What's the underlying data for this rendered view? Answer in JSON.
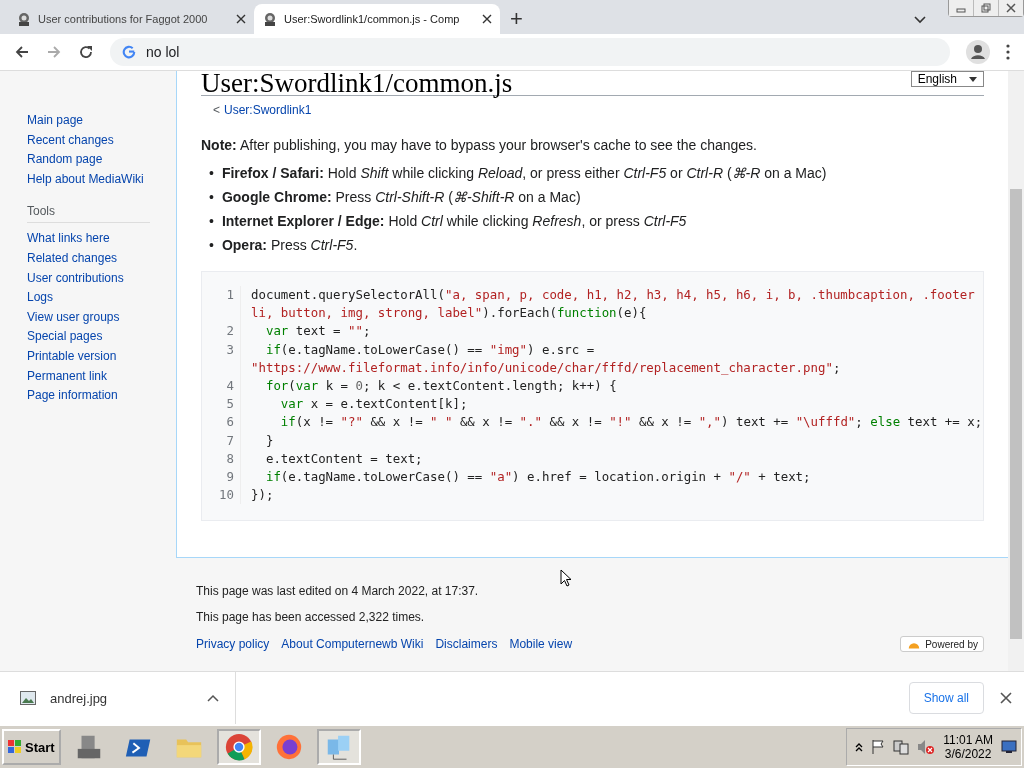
{
  "browser": {
    "tabs": [
      {
        "title": "User contributions for Faggot 2000",
        "selected": false
      },
      {
        "title": "User:Swordlink1/common.js - Comp",
        "selected": true
      }
    ],
    "new_tab": "+",
    "address": "no lol"
  },
  "sidebar": {
    "navigation": [
      "Main page",
      "Recent changes",
      "Random page",
      "Help about MediaWiki"
    ],
    "tools_heading": "Tools",
    "tools": [
      "What links here",
      "Related changes",
      "User contributions",
      "Logs",
      "View user groups",
      "Special pages",
      "Printable version",
      "Permanent link",
      "Page information"
    ]
  },
  "page": {
    "title": "User:Swordlink1/common.js",
    "language": "English",
    "breadcrumb_prefix": "<",
    "breadcrumb": "User:Swordlink1",
    "note": "**Note:** After publishing, you may have to bypass your browser's cache to see the changes.",
    "bullets": [
      {
        "marker": "•",
        "text": "**Firefox / Safari:** Hold *Shift* while clicking *Reload*, or press either *Ctrl-F5* or *Ctrl-R* (*⌘-R* on a Mac)"
      },
      {
        "marker": "•",
        "text": "**Google Chrome:** Press *Ctrl-Shift-R* (*⌘-Shift-R* on a Mac)"
      },
      {
        "marker": "•",
        "text": "**Internet Explorer / Edge:** Hold *Ctrl* while clicking *Refresh*, or press *Ctrl-F5*"
      },
      {
        "marker": "•",
        "text": "**Opera:** Press *Ctrl-F5*."
      }
    ],
    "code": [
      {
        "number": "1",
        "tokens": [
          {
            "kind": "plain",
            "text": "document.querySelectorAll("
          },
          {
            "kind": "string",
            "text": "\"a, span, p, code, h1, h2, h3, h4, h5, h6, i, b, .thumbcaption, .footer li, button, img, strong, label\""
          },
          {
            "kind": "plain",
            "text": ").forEach("
          },
          {
            "kind": "keyword",
            "text": "function"
          },
          {
            "kind": "plain",
            "text": "(e){"
          }
        ]
      },
      {
        "number": "2",
        "tokens": [
          {
            "kind": "keyword",
            "text": "  var"
          },
          {
            "kind": "plain",
            "text": " text = "
          },
          {
            "kind": "string",
            "text": "\"\""
          },
          {
            "kind": "plain",
            "text": ";"
          }
        ]
      },
      {
        "number": "3",
        "tokens": [
          {
            "kind": "keyword",
            "text": "  if"
          },
          {
            "kind": "plain",
            "text": "(e.tagName.toLowerCase() == "
          },
          {
            "kind": "string",
            "text": "\"img\""
          },
          {
            "kind": "plain",
            "text": ") e.src = "
          },
          {
            "kind": "string",
            "text": "\"https://www.fileformat.info/info/unicode/char/fffd/replacement_character.png\""
          },
          {
            "kind": "plain",
            "text": ";"
          }
        ]
      },
      {
        "number": "4",
        "tokens": [
          {
            "kind": "keyword",
            "text": "  for"
          },
          {
            "kind": "plain",
            "text": "("
          },
          {
            "kind": "keyword",
            "text": "var"
          },
          {
            "kind": "plain",
            "text": " k = "
          },
          {
            "kind": "number",
            "text": "0"
          },
          {
            "kind": "plain",
            "text": "; k < e.textContent.length; k++) {"
          }
        ]
      },
      {
        "number": "5",
        "tokens": [
          {
            "kind": "keyword",
            "text": "    var"
          },
          {
            "kind": "plain",
            "text": " x = e.textContent[k];"
          }
        ]
      },
      {
        "number": "6",
        "tokens": [
          {
            "kind": "keyword",
            "text": "    if"
          },
          {
            "kind": "plain",
            "text": "(x != "
          },
          {
            "kind": "string",
            "text": "\"?\""
          },
          {
            "kind": "plain",
            "text": " && x != "
          },
          {
            "kind": "string",
            "text": "\" \""
          },
          {
            "kind": "plain",
            "text": " && x != "
          },
          {
            "kind": "string",
            "text": "\".\""
          },
          {
            "kind": "plain",
            "text": " && x != "
          },
          {
            "kind": "string",
            "text": "\"!\""
          },
          {
            "kind": "plain",
            "text": " && x != "
          },
          {
            "kind": "string",
            "text": "\",\""
          },
          {
            "kind": "plain",
            "text": ") text += "
          },
          {
            "kind": "string",
            "text": "\"\\ufffd\""
          },
          {
            "kind": "plain",
            "text": "; "
          },
          {
            "kind": "keyword",
            "text": "else"
          },
          {
            "kind": "plain",
            "text": " text += x;"
          }
        ]
      },
      {
        "number": "7",
        "tokens": [
          {
            "kind": "plain",
            "text": "  }"
          }
        ]
      },
      {
        "number": "8",
        "tokens": [
          {
            "kind": "plain",
            "text": "  e.textContent = text;"
          }
        ]
      },
      {
        "number": "9",
        "tokens": [
          {
            "kind": "keyword",
            "text": "  if"
          },
          {
            "kind": "plain",
            "text": "(e.tagName.toLowerCase() == "
          },
          {
            "kind": "string",
            "text": "\"a\""
          },
          {
            "kind": "plain",
            "text": ") e.href = location.origin + "
          },
          {
            "kind": "string",
            "text": "\"/\""
          },
          {
            "kind": "plain",
            "text": " + text;"
          }
        ]
      },
      {
        "number": "10",
        "tokens": [
          {
            "kind": "plain",
            "text": "});"
          }
        ]
      }
    ]
  },
  "footer": {
    "info": [
      "This page was last edited on 4 March 2022, at 17:37.",
      "This page has been accessed 2,322 times."
    ],
    "links": [
      "Privacy policy",
      "About Computernewb Wiki",
      "Disclaimers",
      "Mobile view"
    ],
    "powered": "Powered by"
  },
  "download_bar": {
    "file": "andrej.jpg",
    "show_all": "Show all"
  },
  "taskbar": {
    "start": "Start",
    "apps": [
      {
        "selected": false
      },
      {
        "selected": false
      },
      {
        "selected": false
      },
      {
        "selected": true
      },
      {
        "selected": false
      },
      {
        "selected": true
      }
    ],
    "time": "11:01 AM",
    "date": "3/6/2022"
  }
}
